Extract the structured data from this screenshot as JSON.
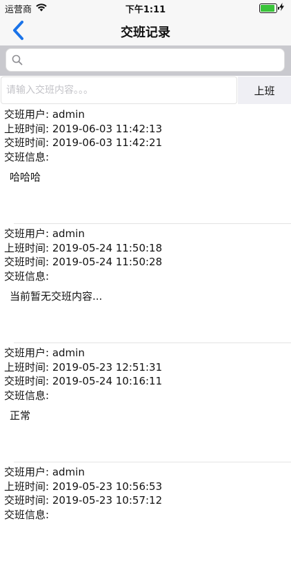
{
  "status": {
    "carrier": "运营商",
    "time": "下午1:11",
    "battery_level": 0.92
  },
  "nav": {
    "title": "交班记录",
    "back_icon": "chevron-left-icon"
  },
  "search": {
    "placeholder": "",
    "value": ""
  },
  "handover": {
    "placeholder": "请输入交班内容。。。",
    "button_label": "上班"
  },
  "records": [
    {
      "user_line": "交班用户: admin",
      "start_line": "上班时间: 2019-06-03 11:42:13",
      "end_line": "交班时间: 2019-06-03 11:42:21",
      "info_label": "交班信息:",
      "message": "哈哈哈"
    },
    {
      "user_line": "交班用户: admin",
      "start_line": "上班时间: 2019-05-24 11:50:18",
      "end_line": "交班时间: 2019-05-24 11:50:28",
      "info_label": "交班信息:",
      "message": "当前暂无交班内容..."
    },
    {
      "user_line": "交班用户: admin",
      "start_line": "上班时间: 2019-05-23 12:51:31",
      "end_line": "交班时间: 2019-05-24 10:16:11",
      "info_label": "交班信息:",
      "message": "正常"
    },
    {
      "user_line": "交班用户: admin",
      "start_line": "上班时间: 2019-05-23 10:56:53",
      "end_line": "交班时间: 2019-05-23 10:57:12",
      "info_label": "交班信息:",
      "message": ""
    }
  ],
  "colors": {
    "accent": "#1a73e8",
    "battery": "#3ac43a"
  }
}
